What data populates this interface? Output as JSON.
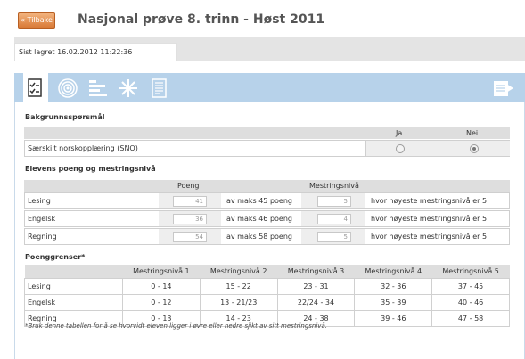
{
  "header": {
    "back_label": "« Tilbake",
    "title": "Nasjonal prøve 8. trinn - Høst 2011"
  },
  "status": {
    "saved_text": "Sist lagret 16.02.2012 11:22:36"
  },
  "toolbar": {
    "tools": [
      "checklist-icon",
      "target-icon",
      "bars-icon",
      "snowflake-icon",
      "document-icon"
    ],
    "right_tool": "export-icon"
  },
  "background": {
    "title": "Bakgrunnsspørsmål",
    "col_yes": "Ja",
    "col_no": "Nei",
    "question": "Særskilt norskopplæring (SNO)",
    "selected": "Nei"
  },
  "scores": {
    "title": "Elevens poeng og mestringsnivå",
    "col_points": "Poeng",
    "col_level": "Mestringsnivå",
    "rows": [
      {
        "subject": "Lesing",
        "points": "41",
        "max": "av maks 45 poeng",
        "level": "5",
        "desc": "hvor høyeste mestringsnivå er 5"
      },
      {
        "subject": "Engelsk",
        "points": "36",
        "max": "av maks 46 poeng",
        "level": "4",
        "desc": "hvor høyeste mestringsnivå er 5"
      },
      {
        "subject": "Regning",
        "points": "54",
        "max": "av maks 58 poeng",
        "level": "5",
        "desc": "hvor høyeste mestringsnivå er 5"
      }
    ]
  },
  "limits": {
    "title": "Poenggrenser*",
    "headers": [
      "",
      "Mestringsnivå 1",
      "Mestringsnivå 2",
      "Mestringsnivå 3",
      "Mestringsnivå 4",
      "Mestringsnivå 5"
    ],
    "rows": [
      [
        "Lesing",
        "0 - 14",
        "15 - 22",
        "23 - 31",
        "32 - 36",
        "37 - 45"
      ],
      [
        "Engelsk",
        "0 - 12",
        "13 - 21/23",
        "22/24 - 34",
        "35 - 39",
        "40 - 46"
      ],
      [
        "Regning",
        "0 - 13",
        "14 - 23",
        "24 - 38",
        "39 - 46",
        "47 - 58"
      ]
    ],
    "footnote": "*Bruk denne tabellen for å se hvorvidt eleven ligger i øvre eller nedre sjikt av sitt mestringsnivå."
  }
}
